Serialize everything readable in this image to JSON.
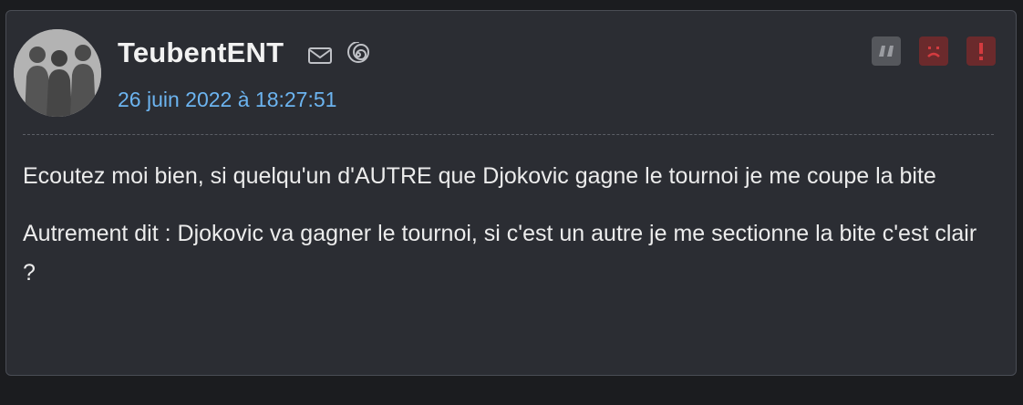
{
  "post": {
    "author": "TeubentENT",
    "date": "26 juin 2022 à 18:27:51",
    "paragraphs": [
      "Ecoutez moi bien, si quelqu'un d'AUTRE que Djokovic gagne le tournoi je me coupe la bite",
      "Autrement dit : Djokovic va gagner le tournoi, si c'est un autre je me sectionne la bite c'est clair ?"
    ]
  },
  "icons": {
    "mail": "mail-icon",
    "profile": "spiral-icon",
    "quote": "quote-icon",
    "sad": "sad-face-icon",
    "alert": "exclamation-icon"
  },
  "colors": {
    "background": "#1b1c1f",
    "card": "#2b2d33",
    "date": "#6cb4f0",
    "danger_button": "#6b2a2c",
    "quote_button": "#55575c"
  }
}
